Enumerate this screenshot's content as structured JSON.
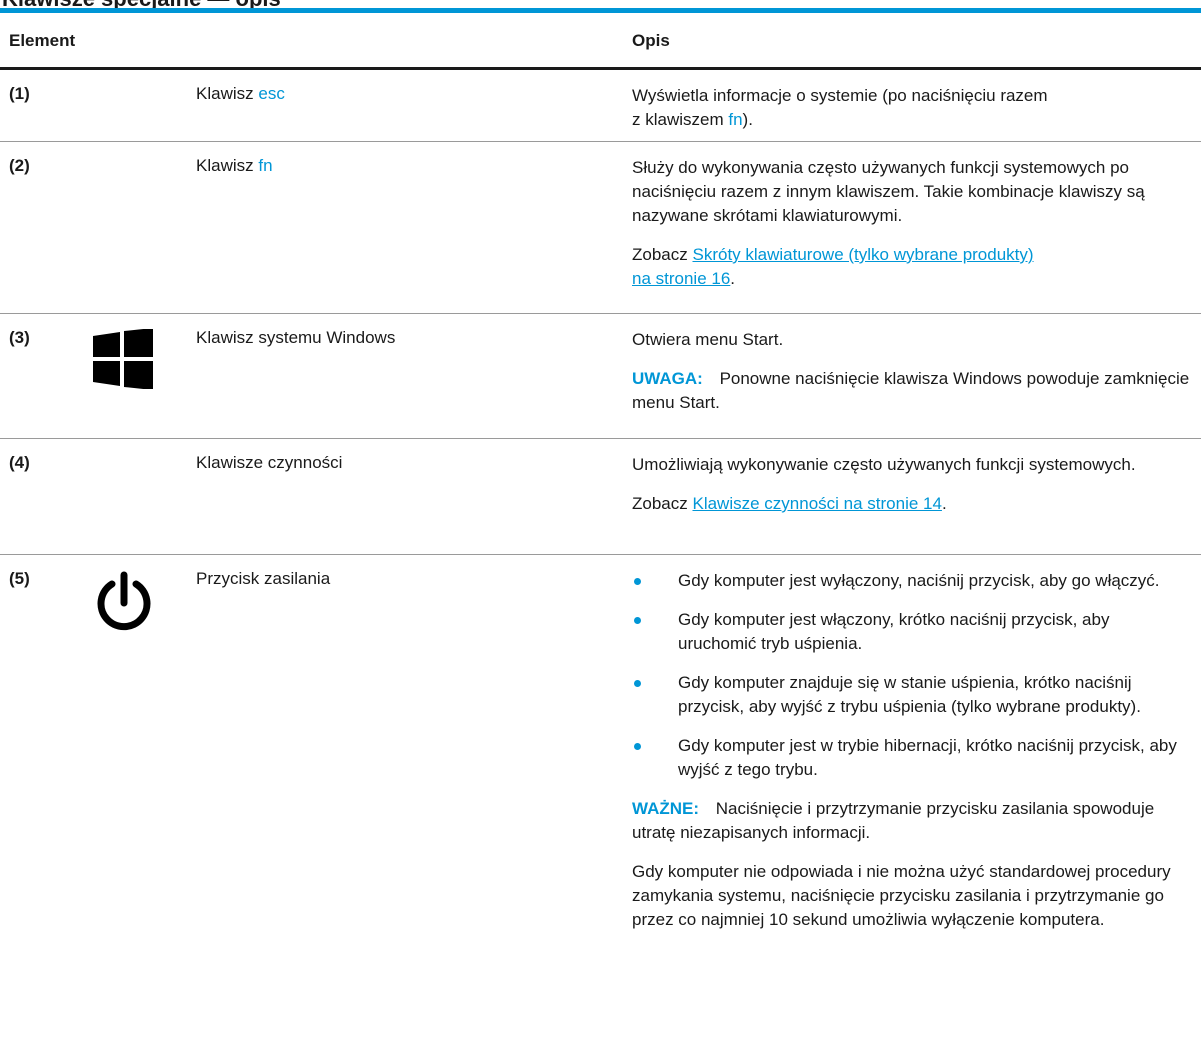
{
  "table": {
    "col_element": "Element",
    "col_desc": "Opis",
    "rows": [
      {
        "num": "(1)",
        "name_prefix": "Klawisz ",
        "name_key": "esc",
        "desc_a": "Wyświetla informacje o systemie (po naciśnięciu razem",
        "desc_b": "z klawiszem ",
        "desc_key": "fn",
        "desc_end": ")."
      },
      {
        "num": "(2)",
        "name_prefix": "Klawisz ",
        "name_key": "fn",
        "desc_text": "Służy do wykonywania często używanych funkcji systemowych po naciśnięciu razem z innym klawiszem. Takie kombinacje klawiszy są nazywane skrótami klawiaturowymi.",
        "see": "Zobacz ",
        "link_a": "Skróty klawiaturowe (tylko wybrane produkty)",
        "link_b": "na stronie 16",
        "link_end": "."
      },
      {
        "num": "(3)",
        "icon": "windows-logo-icon",
        "name": "Klawisz systemu Windows",
        "desc_text": "Otwiera menu Start.",
        "note_label": "UWAGA:",
        "note_text": "Ponowne naciśnięcie klawisza Windows powoduje zamknięcie menu Start."
      },
      {
        "num": "(4)",
        "name": "Klawisze czynności",
        "desc_text": "Umożliwiają wykonywanie często używanych funkcji systemowych.",
        "see": "Zobacz ",
        "link": "Klawisze czynności na stronie 14",
        "link_end": "."
      },
      {
        "num": "(5)",
        "icon": "power-icon",
        "name": "Przycisk zasilania",
        "bullets": [
          "Gdy komputer jest wyłączony, naciśnij przycisk, aby go włączyć.",
          "Gdy komputer jest włączony, krótko naciśnij przycisk, aby uruchomić tryb uśpienia.",
          "Gdy komputer znajduje się w stanie uśpienia, krótko naciśnij przycisk, aby wyjść z trybu uśpienia (tylko wybrane produkty).",
          "Gdy komputer jest w trybie hibernacji, krótko naciśnij przycisk, aby wyjść z tego trybu."
        ],
        "important_label": "WAŻNE:",
        "important_text": "Naciśnięcie i przytrzymanie przycisku zasilania spowoduje utratę niezapisanych informacji.",
        "final_text": "Gdy komputer nie odpowiada i nie można użyć standardowej procedury zamykania systemu, naciśnięcie przycisku zasilania i przytrzymanie go przez co najmniej 10 sekund umożliwia wyłączenie komputera."
      }
    ]
  },
  "colors": {
    "accent": "#0096d6",
    "text": "#1a1a1a"
  }
}
